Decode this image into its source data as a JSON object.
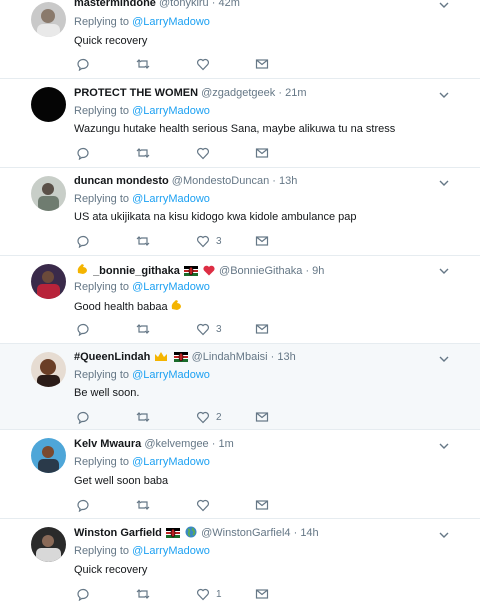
{
  "reply_prefix": "Replying to",
  "tweets": [
    {
      "name": "mastermindone",
      "handle": "@tonykiru",
      "time": "42m",
      "reply_to": "@LarryMadowo",
      "text": "Quick recovery",
      "likes": ""
    },
    {
      "name": "PROTECT THE WOMEN",
      "handle": "@zgadgetgeek",
      "time": "21m",
      "reply_to": "@LarryMadowo",
      "text": "Wazungu hutake health serious Sana, maybe alikuwa tu na stress",
      "likes": ""
    },
    {
      "name": "duncan mondesto",
      "handle": "@MondestoDuncan",
      "time": "13h",
      "reply_to": "@LarryMadowo",
      "text": "US ata ukijikata na kisu kidogo kwa kidole ambulance pap",
      "likes": "3"
    },
    {
      "name": "_bonnie_githaka",
      "handle": "@BonnieGithaka",
      "time": "9h",
      "reply_to": "@LarryMadowo",
      "text": "Good health babaa",
      "likes": "3"
    },
    {
      "name": "#QueenLindah",
      "handle": "@LindahMbaisi",
      "time": "13h",
      "reply_to": "@LarryMadowo",
      "text": "Be well soon.",
      "likes": "2"
    },
    {
      "name": "Kelv Mwaura",
      "handle": "@kelvemgee",
      "time": "1m",
      "reply_to": "@LarryMadowo",
      "text": "Get well soon baba",
      "likes": ""
    },
    {
      "name": "Winston Garfield",
      "handle": "@WinstonGarfiel4",
      "time": "14h",
      "reply_to": "@LarryMadowo",
      "text": "Quick recovery",
      "likes": "1"
    }
  ],
  "colors": {
    "link": "#1da1f2",
    "muted": "#657786",
    "text": "#14171a",
    "divider": "#e6ecf0",
    "highlight_bg": "#f5f8fa"
  },
  "icons": [
    "reply-icon",
    "retweet-icon",
    "like-icon",
    "message-icon",
    "chevron-down-icon",
    "dot-separator"
  ]
}
